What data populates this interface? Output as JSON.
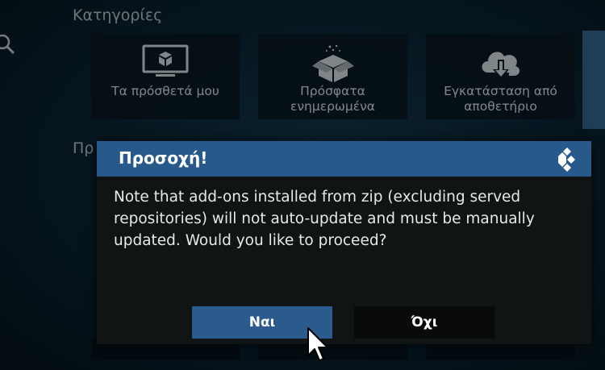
{
  "background": {
    "categories_title": "Κατηγορίες",
    "second_section_title_partial": "Πρ",
    "tiles": [
      {
        "label": "Τα πρόσθετά μου",
        "icon": "my-addons-monitor-box-icon"
      },
      {
        "label": "Πρόσφατα ενημερωμένα",
        "icon": "recently-updated-open-box-icon"
      },
      {
        "label": "Εγκατάσταση από αποθετήριο",
        "icon": "install-from-repository-cloud-icon"
      }
    ]
  },
  "dialog": {
    "title": "Προσοχή!",
    "message": "Note that add-ons installed from zip (excluding served repositories) will not auto-update and must be manually updated. Would you like to proceed?",
    "yes_label": "Ναι",
    "no_label": "Όχι",
    "logo": "kodi-logo-icon"
  },
  "colors": {
    "header": "#275a8a",
    "dialog_body": "#111415",
    "yes_button": "#2b5b8c",
    "no_button": "#080a0b",
    "accent_tile": "#2e5f86"
  }
}
